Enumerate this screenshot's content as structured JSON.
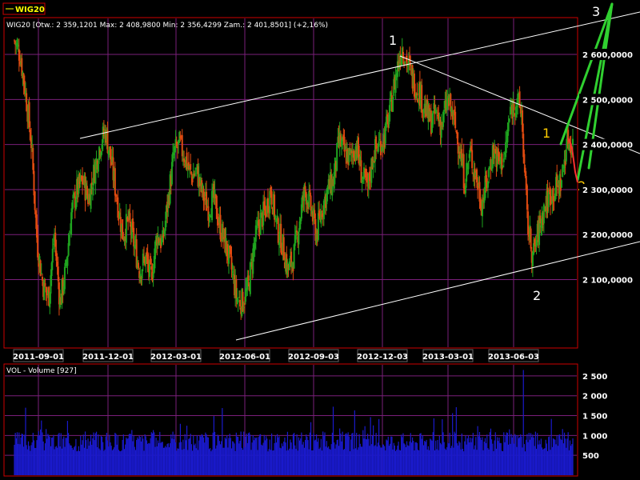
{
  "legend_tag": "WIG20",
  "price_header": "WIG20 [Otw.: 2 359,1201  Max: 2 408,9800  Min: 2 356,4299  Zam.: 2 401,8501]  (+2,16%)",
  "volume_header": "VOL - Volume [927]",
  "colors": {
    "background": "#000000",
    "frame": "#cc0000",
    "grid": "#7a1f7a",
    "up_candle": "#1fa51f",
    "down_candle": "#e04a10",
    "volume": "#1a1acc",
    "trendline": "#ffffff",
    "wave_arrow": "#30d030",
    "red_line": "#ff3030",
    "yellow_label": "#ffcc00"
  },
  "chart_data": [
    {
      "type": "candlestick",
      "title": "WIG20",
      "ylim": [
        2020,
        2500
      ],
      "y_ticks": [
        2100,
        2200,
        2300,
        2400,
        2500,
        2600
      ],
      "y_tick_labels": [
        "2 100,0000",
        "2 200,0000",
        "2 300,0000",
        "2 400,0000",
        "2 500,0000",
        "2 600,0000"
      ],
      "x_tick_labels": [
        "2011-09-01",
        "2011-12-01",
        "2012-03-01",
        "2012-06-01",
        "2012-09-03",
        "2012-12-03",
        "2013-03-01",
        "2013-06-03"
      ],
      "last_values": {
        "open": 2359.1201,
        "high": 2408.98,
        "low": 2356.4299,
        "close": 2401.8501,
        "change": "+2,16%"
      },
      "close_path": [
        {
          "i": 0,
          "v": 2630
        },
        {
          "i": 1,
          "v": 2600
        },
        {
          "i": 2,
          "v": 2510
        },
        {
          "i": 3,
          "v": 2400
        },
        {
          "i": 4,
          "v": 2180
        },
        {
          "i": 5,
          "v": 2090
        },
        {
          "i": 6,
          "v": 2060
        },
        {
          "i": 7,
          "v": 2200
        },
        {
          "i": 8,
          "v": 2050
        },
        {
          "i": 9,
          "v": 2120
        },
        {
          "i": 10,
          "v": 2250
        },
        {
          "i": 11,
          "v": 2300
        },
        {
          "i": 12,
          "v": 2320
        },
        {
          "i": 13,
          "v": 2280
        },
        {
          "i": 14,
          "v": 2340
        },
        {
          "i": 15,
          "v": 2400
        },
        {
          "i": 16,
          "v": 2430
        },
        {
          "i": 17,
          "v": 2360
        },
        {
          "i": 18,
          "v": 2280
        },
        {
          "i": 19,
          "v": 2200
        },
        {
          "i": 20,
          "v": 2230
        },
        {
          "i": 21,
          "v": 2180
        },
        {
          "i": 22,
          "v": 2120
        },
        {
          "i": 23,
          "v": 2150
        },
        {
          "i": 24,
          "v": 2100
        },
        {
          "i": 25,
          "v": 2200
        },
        {
          "i": 26,
          "v": 2180
        },
        {
          "i": 27,
          "v": 2280
        },
        {
          "i": 28,
          "v": 2380
        },
        {
          "i": 29,
          "v": 2400
        },
        {
          "i": 30,
          "v": 2370
        },
        {
          "i": 31,
          "v": 2330
        },
        {
          "i": 32,
          "v": 2340
        },
        {
          "i": 33,
          "v": 2290
        },
        {
          "i": 34,
          "v": 2260
        },
        {
          "i": 35,
          "v": 2280
        },
        {
          "i": 36,
          "v": 2220
        },
        {
          "i": 37,
          "v": 2180
        },
        {
          "i": 38,
          "v": 2130
        },
        {
          "i": 39,
          "v": 2060
        },
        {
          "i": 40,
          "v": 2050
        },
        {
          "i": 41,
          "v": 2080
        },
        {
          "i": 42,
          "v": 2170
        },
        {
          "i": 43,
          "v": 2230
        },
        {
          "i": 44,
          "v": 2250
        },
        {
          "i": 45,
          "v": 2300
        },
        {
          "i": 46,
          "v": 2220
        },
        {
          "i": 47,
          "v": 2180
        },
        {
          "i": 48,
          "v": 2120
        },
        {
          "i": 49,
          "v": 2150
        },
        {
          "i": 50,
          "v": 2230
        },
        {
          "i": 51,
          "v": 2300
        },
        {
          "i": 52,
          "v": 2260
        },
        {
          "i": 53,
          "v": 2200
        },
        {
          "i": 54,
          "v": 2260
        },
        {
          "i": 55,
          "v": 2300
        },
        {
          "i": 56,
          "v": 2320
        },
        {
          "i": 57,
          "v": 2410
        },
        {
          "i": 58,
          "v": 2380
        },
        {
          "i": 59,
          "v": 2370
        },
        {
          "i": 60,
          "v": 2400
        },
        {
          "i": 61,
          "v": 2330
        },
        {
          "i": 62,
          "v": 2300
        },
        {
          "i": 63,
          "v": 2380
        },
        {
          "i": 64,
          "v": 2400
        },
        {
          "i": 65,
          "v": 2420
        },
        {
          "i": 66,
          "v": 2480
        },
        {
          "i": 67,
          "v": 2560
        },
        {
          "i": 68,
          "v": 2620
        },
        {
          "i": 69,
          "v": 2580
        },
        {
          "i": 70,
          "v": 2540
        },
        {
          "i": 71,
          "v": 2520
        },
        {
          "i": 72,
          "v": 2480
        },
        {
          "i": 73,
          "v": 2450
        },
        {
          "i": 74,
          "v": 2470
        },
        {
          "i": 75,
          "v": 2440
        },
        {
          "i": 76,
          "v": 2500
        },
        {
          "i": 77,
          "v": 2460
        },
        {
          "i": 78,
          "v": 2400
        },
        {
          "i": 79,
          "v": 2320
        },
        {
          "i": 80,
          "v": 2380
        },
        {
          "i": 81,
          "v": 2330
        },
        {
          "i": 82,
          "v": 2270
        },
        {
          "i": 83,
          "v": 2320
        },
        {
          "i": 84,
          "v": 2390
        },
        {
          "i": 85,
          "v": 2360
        },
        {
          "i": 86,
          "v": 2370
        },
        {
          "i": 87,
          "v": 2470
        },
        {
          "i": 88,
          "v": 2500
        },
        {
          "i": 89,
          "v": 2470
        },
        {
          "i": 90,
          "v": 2230
        },
        {
          "i": 91,
          "v": 2150
        },
        {
          "i": 92,
          "v": 2210
        },
        {
          "i": 93,
          "v": 2260
        },
        {
          "i": 94,
          "v": 2290
        },
        {
          "i": 95,
          "v": 2300
        },
        {
          "i": 96,
          "v": 2320
        },
        {
          "i": 97,
          "v": 2410
        },
        {
          "i": 98,
          "v": 2401
        }
      ]
    },
    {
      "type": "bar",
      "title": "VOL - Volume [927]",
      "ylim": [
        0,
        2700
      ],
      "y_ticks": [
        500,
        1000,
        1500,
        2000,
        2500
      ],
      "y_tick_labels": [
        "500",
        "1 000",
        "1 500",
        "2 000",
        "2 500"
      ],
      "last_value": 927
    }
  ],
  "annotations": {
    "wave_1_top": "1",
    "wave_2_bottom": "2",
    "wave_3_top": "3",
    "minor_1": "1",
    "minor_2": "2"
  }
}
